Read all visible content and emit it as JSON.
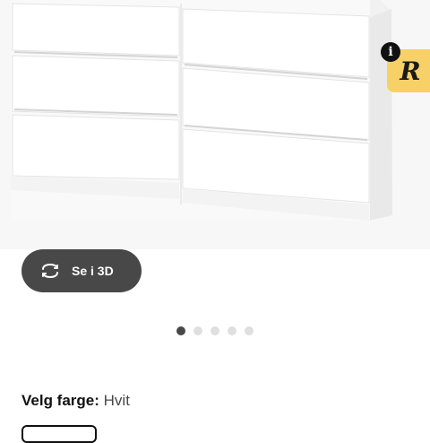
{
  "hero": {
    "badge_letter": "R",
    "info_symbol": "i"
  },
  "view_3d": {
    "label": "Se i 3D",
    "icon": "rotate-3d-icon"
  },
  "carousel": {
    "count": 5,
    "active_index": 0
  },
  "color_picker": {
    "label": "Velg farge:",
    "value": "Hvit"
  },
  "colors": {
    "button_bg": "#484848",
    "badge_bg": "#f7d167",
    "dot_active": "#484848",
    "dot_inactive": "#dfdfdf"
  }
}
